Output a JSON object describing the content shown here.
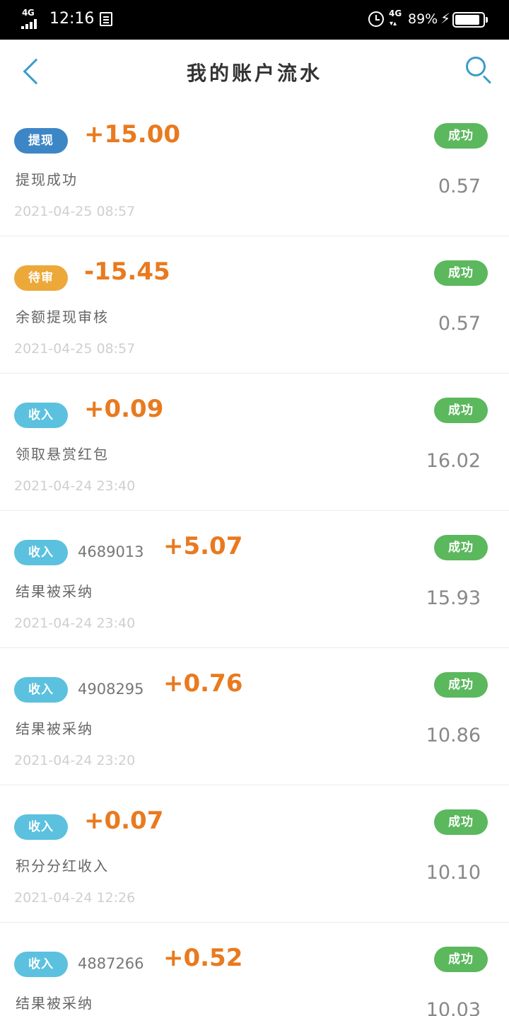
{
  "status_bar": {
    "network": "4G",
    "time": "12:16",
    "network2": "4G",
    "battery_percent": "89%",
    "battery_level": 0.89
  },
  "header": {
    "title": "我的账户流水",
    "back_icon": "chevron-left-icon",
    "search_icon": "search-icon"
  },
  "colors": {
    "accent": "#3a9dc9",
    "amount": "#e97a1f",
    "success": "#5bb85d",
    "tag_withdraw": "#3d86c6",
    "tag_pending": "#eca93a",
    "tag_income": "#5bc1df"
  },
  "transactions": [
    {
      "tag": "提现",
      "tag_type": "withdraw",
      "ref": "",
      "amount": "+15.00",
      "status": "成功",
      "desc": "提现成功",
      "balance": "0.57",
      "date": "2021-04-25 08:57"
    },
    {
      "tag": "待审",
      "tag_type": "pending",
      "ref": "",
      "amount": "-15.45",
      "status": "成功",
      "desc": "余额提现审核",
      "balance": "0.57",
      "date": "2021-04-25 08:57"
    },
    {
      "tag": "收入",
      "tag_type": "income",
      "ref": "",
      "amount": "+0.09",
      "status": "成功",
      "desc": "领取悬赏红包",
      "balance": "16.02",
      "date": "2021-04-24 23:40"
    },
    {
      "tag": "收入",
      "tag_type": "income",
      "ref": "4689013",
      "amount": "+5.07",
      "status": "成功",
      "desc": "结果被采纳",
      "balance": "15.93",
      "date": "2021-04-24 23:40"
    },
    {
      "tag": "收入",
      "tag_type": "income",
      "ref": "4908295",
      "amount": "+0.76",
      "status": "成功",
      "desc": "结果被采纳",
      "balance": "10.86",
      "date": "2021-04-24 23:20"
    },
    {
      "tag": "收入",
      "tag_type": "income",
      "ref": "",
      "amount": "+0.07",
      "status": "成功",
      "desc": "积分分红收入",
      "balance": "10.10",
      "date": "2021-04-24 12:26"
    },
    {
      "tag": "收入",
      "tag_type": "income",
      "ref": "4887266",
      "amount": "+0.52",
      "status": "成功",
      "desc": "结果被采纳",
      "balance": "10.03",
      "date": ""
    }
  ]
}
